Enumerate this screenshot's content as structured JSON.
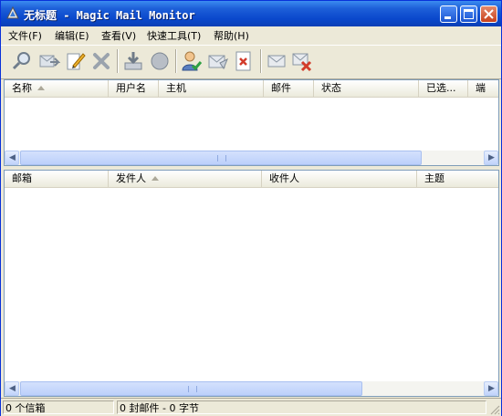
{
  "window": {
    "title": "无标题 - Magic Mail Monitor"
  },
  "menu": [
    {
      "label": "文件(F)"
    },
    {
      "label": "编辑(E)"
    },
    {
      "label": "查看(V)"
    },
    {
      "label": "快速工具(T)"
    },
    {
      "label": "帮助(H)"
    }
  ],
  "toolbar": {
    "icons": [
      "search-icon",
      "forward-icon",
      "edit-icon",
      "delete-icon",
      "download-icon",
      "stop-icon",
      "user-check-icon",
      "send-mail-icon",
      "page-delete-icon",
      "envelope-icon",
      "mail-delete-icon"
    ]
  },
  "accounts_table": {
    "columns": [
      "名称",
      "用户名",
      "主机",
      "邮件",
      "状态",
      "已选...",
      "端"
    ]
  },
  "messages_table": {
    "columns": [
      "邮箱",
      "发件人",
      "收件人",
      "主题"
    ]
  },
  "status": {
    "mailboxes": "0 个信箱",
    "summary": "0 封邮件 - 0 字节"
  },
  "colors": {
    "titlebar": "#0a48cc",
    "face": "#ece9d8",
    "border": "#7f9db9"
  }
}
